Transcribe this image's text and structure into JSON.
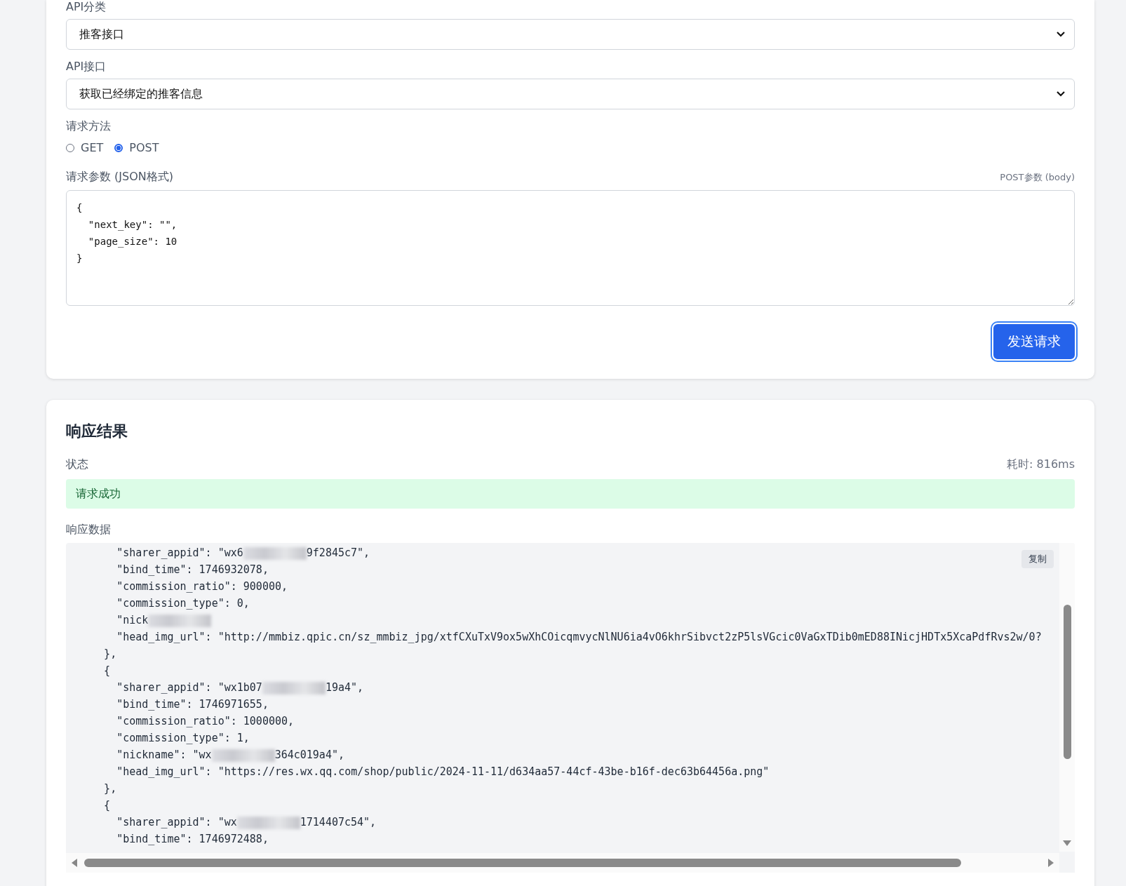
{
  "request_form": {
    "category_label": "API分类",
    "category_value": "推客接口",
    "api_label": "API接口",
    "api_value": "获取已经绑定的推客信息",
    "method_label": "请求方法",
    "methods": [
      {
        "label": "GET",
        "selected": false
      },
      {
        "label": "POST",
        "selected": true
      }
    ],
    "params_label": "请求参数 (JSON格式)",
    "params_hint": "POST参数 (body)",
    "params_value": "{\n  \"next_key\": \"\",\n  \"page_size\": 10\n}",
    "send_button": "发送请求"
  },
  "response": {
    "title": "响应结果",
    "status_label": "状态",
    "elapsed": "耗时: 816ms",
    "status_message": "请求成功",
    "status_ok": true,
    "data_label": "响应数据",
    "copy_button": "复制",
    "lines": [
      {
        "text": "      \"sharer_appid\": \"wx6",
        "masked": true,
        "rest": "9f2845c7\","
      },
      {
        "text": "      \"bind_time\": 1746932078,"
      },
      {
        "text": "      \"commission_ratio\": 900000,"
      },
      {
        "text": "      \"commission_type\": 0,"
      },
      {
        "text": "      \"nick",
        "masked": true
      },
      {
        "text": "      \"head_img_url\": \"http://mmbiz.qpic.cn/sz_mmbiz_jpg/xtfCXuTxV9ox5wXhCOicqmvycNlNU6ia4vO6khrSibvct2zP5lsVGcic0VaGxTDib0mED88INicjHDTx5XcaPdfRvs2w/0?"
      },
      {
        "text": "    },"
      },
      {
        "text": "    {"
      },
      {
        "text": "      \"sharer_appid\": \"wx1b07",
        "masked": true,
        "rest": "19a4\","
      },
      {
        "text": "      \"bind_time\": 1746971655,"
      },
      {
        "text": "      \"commission_ratio\": 1000000,"
      },
      {
        "text": "      \"commission_type\": 1,"
      },
      {
        "text": "      \"nickname\": \"wx",
        "masked": true,
        "rest": "364c019a4\","
      },
      {
        "text": "      \"head_img_url\": \"https://res.wx.qq.com/shop/public/2024-11-11/d634aa57-44cf-43be-b16f-dec63b64456a.png\""
      },
      {
        "text": "    },"
      },
      {
        "text": "    {"
      },
      {
        "text": "      \"sharer_appid\": \"wx",
        "masked": true,
        "rest": "1714407c54\","
      },
      {
        "text": "      \"bind_time\": 1746972488,"
      }
    ]
  }
}
